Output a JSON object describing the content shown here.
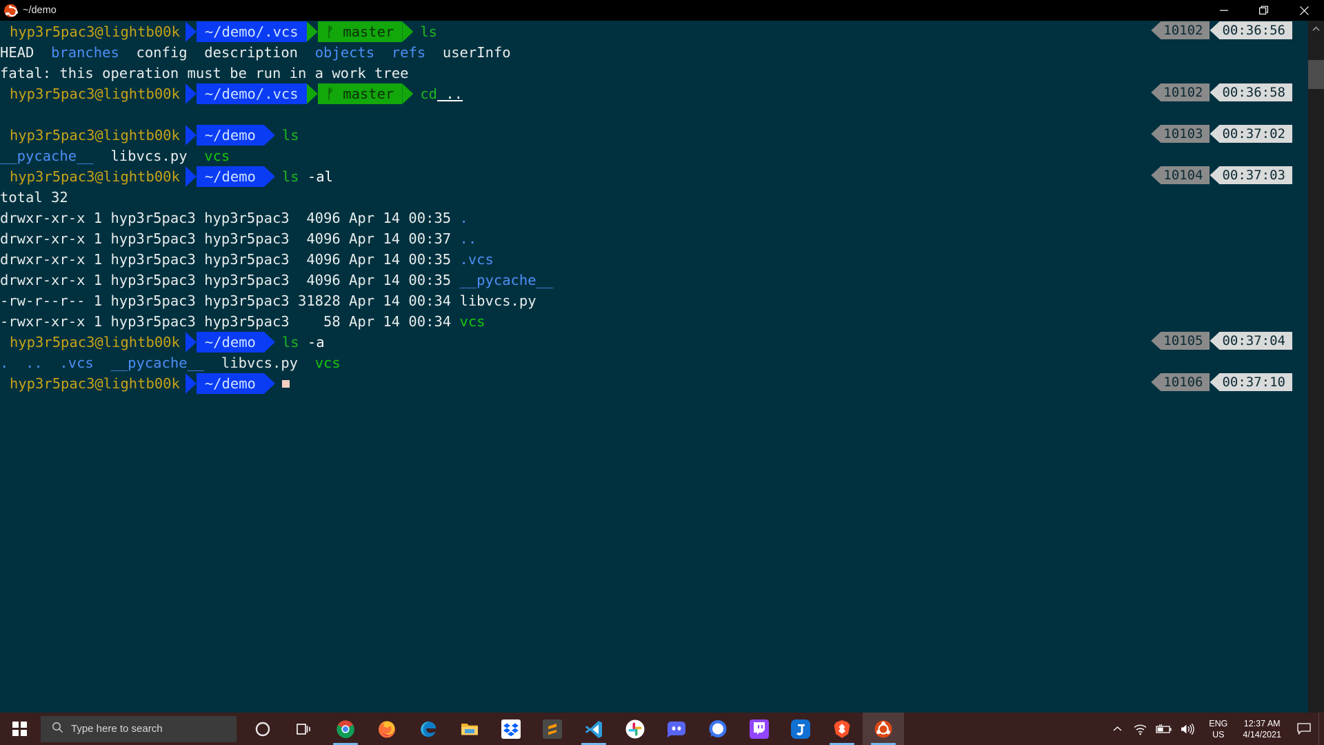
{
  "window": {
    "title": "~/demo",
    "icon": "ubuntu-logo",
    "controls": {
      "minimize": "minimize",
      "maximize": "restore",
      "close": "close"
    }
  },
  "terminal": {
    "background": "#01313f",
    "foreground": "#d7e3e3",
    "prompt": {
      "user_host": "hyp3r5pac3@lightb00k",
      "user_color": "#c8a317",
      "path_bg": "#0b3cf5",
      "git_bg": "#12a80b",
      "git_glyph": "ᚠ",
      "cursor_color": "#f6d0c3"
    },
    "lines": [
      {
        "kind": "prompt",
        "user_host": "hyp3r5pac3@lightb00k",
        "path": "~/demo/.vcs",
        "branch": "master",
        "command": "ls",
        "command_arg": "",
        "badge": {
          "id": "10102",
          "time": "00:36:56"
        }
      },
      {
        "kind": "output",
        "parts": [
          {
            "text": "HEAD",
            "color": "white"
          },
          {
            "text": "  ",
            "color": "white"
          },
          {
            "text": "branches",
            "color": "blue"
          },
          {
            "text": "  ",
            "color": "white"
          },
          {
            "text": "config",
            "color": "white"
          },
          {
            "text": "  ",
            "color": "white"
          },
          {
            "text": "description",
            "color": "white"
          },
          {
            "text": "  ",
            "color": "white"
          },
          {
            "text": "objects",
            "color": "blue"
          },
          {
            "text": "  ",
            "color": "white"
          },
          {
            "text": "refs",
            "color": "blue"
          },
          {
            "text": "  ",
            "color": "white"
          },
          {
            "text": "userInfo",
            "color": "white"
          }
        ]
      },
      {
        "kind": "output",
        "parts": [
          {
            "text": "fatal: this operation must be run in a work tree",
            "color": "white"
          }
        ]
      },
      {
        "kind": "prompt",
        "user_host": "hyp3r5pac3@lightb00k",
        "path": "~/demo/.vcs",
        "branch": "master",
        "command": "cd",
        "command_arg": "..",
        "badge": {
          "id": "10102",
          "time": "00:36:58"
        }
      },
      {
        "kind": "blank"
      },
      {
        "kind": "prompt",
        "user_host": "hyp3r5pac3@lightb00k",
        "path": "~/demo",
        "branch": "",
        "command": "ls",
        "command_arg": "",
        "badge": {
          "id": "10103",
          "time": "00:37:02"
        }
      },
      {
        "kind": "output",
        "parts": [
          {
            "text": "__pycache__",
            "color": "blue"
          },
          {
            "text": "  ",
            "color": "white"
          },
          {
            "text": "libvcs.py",
            "color": "white"
          },
          {
            "text": "  ",
            "color": "white"
          },
          {
            "text": "vcs",
            "color": "green"
          }
        ]
      },
      {
        "kind": "prompt",
        "user_host": "hyp3r5pac3@lightb00k",
        "path": "~/demo",
        "branch": "",
        "command": "ls",
        "command_arg": "-al",
        "badge": {
          "id": "10104",
          "time": "00:37:03"
        }
      },
      {
        "kind": "output",
        "parts": [
          {
            "text": "total 32",
            "color": "white"
          }
        ]
      },
      {
        "kind": "output",
        "parts": [
          {
            "text": "drwxr-xr-x 1 hyp3r5pac3 hyp3r5pac3  4096 Apr 14 00:35 ",
            "color": "white"
          },
          {
            "text": ".",
            "color": "blue"
          }
        ]
      },
      {
        "kind": "output",
        "parts": [
          {
            "text": "drwxr-xr-x 1 hyp3r5pac3 hyp3r5pac3  4096 Apr 14 00:37 ",
            "color": "white"
          },
          {
            "text": "..",
            "color": "blue"
          }
        ]
      },
      {
        "kind": "output",
        "parts": [
          {
            "text": "drwxr-xr-x 1 hyp3r5pac3 hyp3r5pac3  4096 Apr 14 00:35 ",
            "color": "white"
          },
          {
            "text": ".vcs",
            "color": "blue"
          }
        ]
      },
      {
        "kind": "output",
        "parts": [
          {
            "text": "drwxr-xr-x 1 hyp3r5pac3 hyp3r5pac3  4096 Apr 14 00:35 ",
            "color": "white"
          },
          {
            "text": "__pycache__",
            "color": "blue"
          }
        ]
      },
      {
        "kind": "output",
        "parts": [
          {
            "text": "-rw-r--r-- 1 hyp3r5pac3 hyp3r5pac3 31828 Apr 14 00:34 ",
            "color": "white"
          },
          {
            "text": "libvcs.py",
            "color": "white"
          }
        ]
      },
      {
        "kind": "output",
        "parts": [
          {
            "text": "-rwxr-xr-x 1 hyp3r5pac3 hyp3r5pac3    58 Apr 14 00:34 ",
            "color": "white"
          },
          {
            "text": "vcs",
            "color": "green"
          }
        ]
      },
      {
        "kind": "prompt",
        "user_host": "hyp3r5pac3@lightb00k",
        "path": "~/demo",
        "branch": "",
        "command": "ls",
        "command_arg": "-a",
        "badge": {
          "id": "10105",
          "time": "00:37:04"
        }
      },
      {
        "kind": "output",
        "parts": [
          {
            "text": ".",
            "color": "blue"
          },
          {
            "text": "  ",
            "color": "white"
          },
          {
            "text": "..",
            "color": "blue"
          },
          {
            "text": "  ",
            "color": "white"
          },
          {
            "text": ".vcs",
            "color": "blue"
          },
          {
            "text": "  ",
            "color": "white"
          },
          {
            "text": "__pycache__",
            "color": "blue"
          },
          {
            "text": "  ",
            "color": "white"
          },
          {
            "text": "libvcs.py",
            "color": "white"
          },
          {
            "text": "  ",
            "color": "white"
          },
          {
            "text": "vcs",
            "color": "green"
          }
        ]
      },
      {
        "kind": "prompt-cursor",
        "user_host": "hyp3r5pac3@lightb00k",
        "path": "~/demo",
        "branch": "",
        "command": "",
        "command_arg": "",
        "badge": {
          "id": "10106",
          "time": "00:37:10"
        }
      }
    ]
  },
  "scrollbar": {
    "up_arrow": "chevron-up-icon"
  },
  "taskbar": {
    "background": "#3a1f1f",
    "start_label": "Start",
    "search": {
      "placeholder": "Type here to search",
      "icon": "search-icon"
    },
    "items": [
      {
        "name": "cortana",
        "label": "Cortana",
        "active": false,
        "running": false
      },
      {
        "name": "task-view",
        "label": "Task View",
        "active": false,
        "running": false
      },
      {
        "name": "chrome",
        "label": "Google Chrome",
        "active": false,
        "running": true
      },
      {
        "name": "firefox",
        "label": "Firefox",
        "active": false,
        "running": false
      },
      {
        "name": "edge",
        "label": "Microsoft Edge",
        "active": false,
        "running": false
      },
      {
        "name": "file-explorer",
        "label": "File Explorer",
        "active": false,
        "running": false
      },
      {
        "name": "dropbox",
        "label": "Dropbox",
        "active": false,
        "running": false
      },
      {
        "name": "sublime-text",
        "label": "Sublime Text",
        "active": false,
        "running": false
      },
      {
        "name": "vs-code",
        "label": "Visual Studio Code",
        "active": false,
        "running": true
      },
      {
        "name": "slack",
        "label": "Slack",
        "active": false,
        "running": false
      },
      {
        "name": "discord",
        "label": "Discord",
        "active": false,
        "running": false
      },
      {
        "name": "signal",
        "label": "Signal",
        "active": false,
        "running": false
      },
      {
        "name": "twitch",
        "label": "Twitch",
        "active": false,
        "running": false
      },
      {
        "name": "joplin",
        "label": "Joplin",
        "active": false,
        "running": false
      },
      {
        "name": "brave",
        "label": "Brave",
        "active": false,
        "running": true
      },
      {
        "name": "ubuntu",
        "label": "Ubuntu",
        "active": true,
        "running": true
      }
    ],
    "tray": {
      "chevron": "chevron-up-icon",
      "wifi": "wifi-icon",
      "battery": "battery-charging-icon",
      "volume": "volume-icon",
      "language_line1": "ENG",
      "language_line2": "US",
      "time": "12:37 AM",
      "date": "4/14/2021",
      "notifications": "notification-icon"
    }
  }
}
